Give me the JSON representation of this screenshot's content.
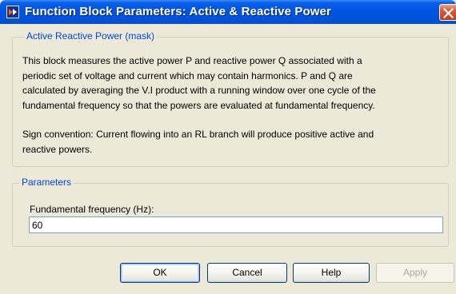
{
  "window": {
    "title": "Function Block Parameters: Active & Reactive Power"
  },
  "mask": {
    "group_label": "Active  Reactive Power (mask)",
    "paragraph1_line1": "This block measures the active power P and reactive power Q  associated with a",
    "paragraph1_line2": "periodic  set of voltage and current which may contain harmonics. P and Q are",
    "paragraph1_line3": "calculated by averaging the V.I product with a running window over one cycle of the",
    "paragraph1_line4": "fundamental frequency so that the powers are evaluated at fundamental frequency.",
    "paragraph2_line1": "Sign convention: Current flowing into an RL branch will produce positive active and",
    "paragraph2_line2": "reactive powers."
  },
  "parameters": {
    "group_label": "Parameters",
    "frequency_label": "Fundamental frequency (Hz):",
    "frequency_value": "60"
  },
  "buttons": {
    "ok": "OK",
    "cancel": "Cancel",
    "help": "Help",
    "apply": "Apply"
  },
  "icons": {
    "app_icon": "simulink-block-icon",
    "close_icon": "close-x-icon"
  }
}
